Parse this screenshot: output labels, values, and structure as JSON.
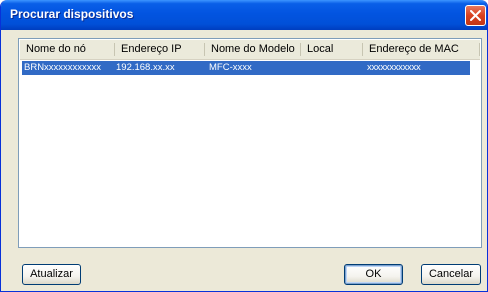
{
  "window": {
    "title": "Procurar dispositivos"
  },
  "list": {
    "columns": [
      "Nome do nó",
      "Endereço IP",
      "Nome do Modelo",
      "Local",
      "Endereço de MAC"
    ],
    "rows": [
      {
        "node": "BRNxxxxxxxxxxxx",
        "ip": "192.168.xx.xx",
        "model": "MFC-xxxx",
        "location": "",
        "mac": "xxxxxxxxxxxx",
        "selected": true
      }
    ]
  },
  "buttons": {
    "refresh": "Atualizar",
    "ok": "OK",
    "cancel": "Cancelar"
  },
  "colors": {
    "titlebar": "#0254e0",
    "selection": "#316ac5",
    "dialog_bg": "#ece9d8",
    "close_button": "#d8401f"
  }
}
